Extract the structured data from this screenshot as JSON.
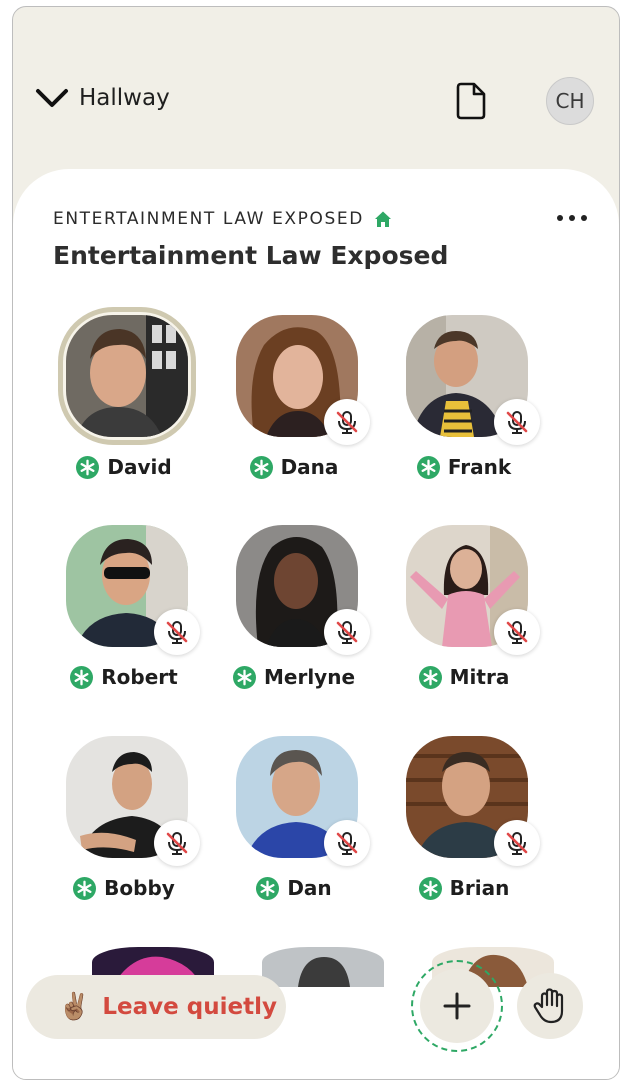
{
  "header": {
    "back_label": "Hallway",
    "user_initials": "CH",
    "icons": {
      "back": "chevron-down-icon",
      "document": "document-icon"
    }
  },
  "room": {
    "club_name": "ENTERTAINMENT LAW EXPOSED",
    "title": "Entertainment Law Exposed",
    "club_icon": "house-icon",
    "menu_icon": "more-horizontal-icon"
  },
  "speakers": [
    {
      "name": "David",
      "muted": false,
      "speaking": true
    },
    {
      "name": "Dana",
      "muted": true
    },
    {
      "name": "Frank",
      "muted": true
    },
    {
      "name": "Robert",
      "muted": true
    },
    {
      "name": "Merlyne",
      "muted": true
    },
    {
      "name": "Mitra",
      "muted": true
    },
    {
      "name": "Bobby",
      "muted": true
    },
    {
      "name": "Dan",
      "muted": true
    },
    {
      "name": "Brian",
      "muted": true
    }
  ],
  "footer": {
    "leave_label": "Leave quietly",
    "leave_emoji": "✌🏽",
    "add_icon": "plus-icon",
    "raise_hand_icon": "raised-hand-icon"
  },
  "colors": {
    "header_bg": "#f1efe7",
    "moderator_badge": "#2ea865",
    "leave_text": "#d34a3f",
    "button_bg": "#ece9e0"
  }
}
